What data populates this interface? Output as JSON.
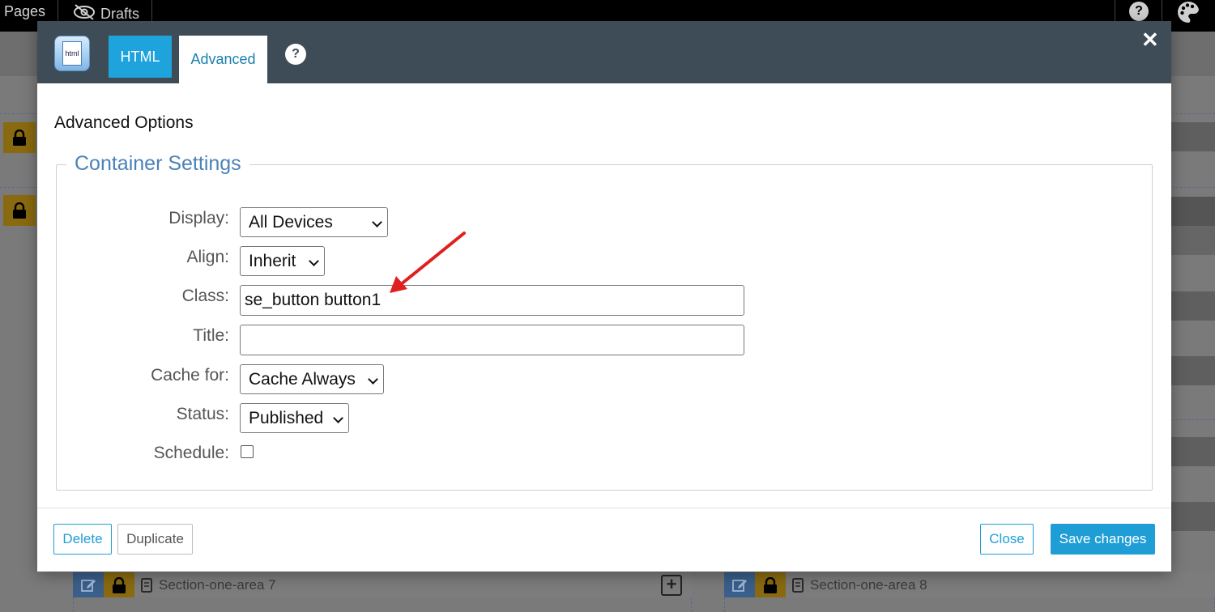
{
  "topbar": {
    "pages_label": "Pages",
    "drafts_label": "Drafts",
    "help_glyph": "?"
  },
  "background": {
    "areas": [
      {
        "name": "Section-one-area 7"
      },
      {
        "name": "Section-one-area 8"
      }
    ]
  },
  "modal": {
    "tabs": {
      "html_label": "HTML",
      "advanced_label": "Advanced"
    },
    "logo_text": "html",
    "help_glyph": "?",
    "close_glyph": "✕",
    "title": "Advanced Options",
    "fieldset_legend": "Container Settings",
    "fields": {
      "display": {
        "label": "Display:",
        "value": "All Devices"
      },
      "align": {
        "label": "Align:",
        "value": "Inherit"
      },
      "class": {
        "label": "Class:",
        "value": "se_button button1"
      },
      "title": {
        "label": "Title:",
        "value": ""
      },
      "cache": {
        "label": "Cache for:",
        "value": "Cache Always"
      },
      "status": {
        "label": "Status:",
        "value": "Published"
      },
      "schedule": {
        "label": "Schedule:",
        "checked": false
      }
    },
    "footer": {
      "delete_label": "Delete",
      "duplicate_label": "Duplicate",
      "close_label": "Close",
      "save_label": "Save changes"
    }
  },
  "colors": {
    "header_bg": "#3e4c57",
    "accent": "#1f9ed6",
    "legend": "#4b82b8",
    "annotation_arrow": "#e02020"
  }
}
